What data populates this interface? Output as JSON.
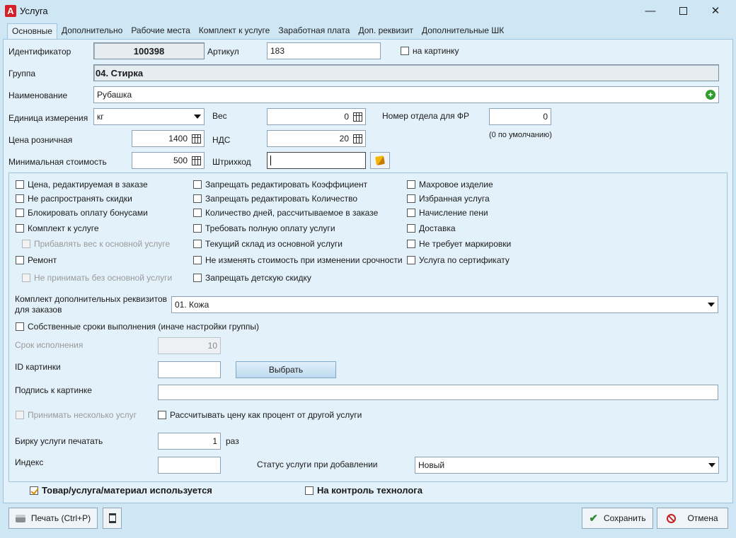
{
  "window": {
    "title": "Услуга",
    "app_icon": "A"
  },
  "tabs": [
    "Основные",
    "Дополнительно",
    "Рабочие места",
    "Комплект к услуге",
    "Заработная плата",
    "Доп. реквизит",
    "Дополнительные ШК"
  ],
  "fields": {
    "id_label": "Идентификатор",
    "id_value": "100398",
    "article_label": "Артикул",
    "article_value": "183",
    "on_picture_label": "на картинку",
    "group_label": "Группа",
    "group_value": "04. Стирка",
    "name_label": "Наименование",
    "name_value": "Рубашка",
    "unit_label": "Единица измерения",
    "unit_value": "кг",
    "weight_label": "Вес",
    "weight_value": "0",
    "dept_label": "Номер отдела для ФР",
    "dept_value": "0",
    "dept_hint": "(0 по умолчанию)",
    "price_label": "Цена розничная",
    "price_value": "1400",
    "vat_label": "НДС",
    "vat_value": "20",
    "min_cost_label": "Минимальная стоимость",
    "min_cost_value": "500",
    "barcode_label": "Штрихкод",
    "barcode_value": ""
  },
  "checks": {
    "c1": "Цена, редактируемая в заказе",
    "c2": "Не распространять скидки",
    "c3": "Блокировать оплату бонусами",
    "c4": "Комплект к услуге",
    "c5": "Прибавлять вес к основной услуге",
    "c6": "Ремонт",
    "c7": "Не принимать без основной услуги",
    "m1": "Запрещать редактировать Коэффициент",
    "m2": "Запрещать редактировать Количество",
    "m3": "Количество дней, рассчитываемое в заказе",
    "m4": "Требовать полную оплату услуги",
    "m5": "Текущий склад из основной услуги",
    "m6": "Не изменять стоимость при изменении срочности",
    "m7": "Запрещать детскую скидку",
    "r1": "Махровое изделие",
    "r2": "Избранная услуга",
    "r3": "Начисление пени",
    "r4": "Доставка",
    "r5": "Не требует маркировки",
    "r6": "Услуга по сертификату"
  },
  "extra": {
    "kit_label_1": "Комплект дополнительных реквизитов",
    "kit_label_2": "для заказов",
    "kit_value": "01. Кожа",
    "own_terms_label": "Собственные сроки выполнения (иначе настройки группы)",
    "term_label": "Срок исполнения",
    "term_value": "10",
    "pic_id_label": "ID картинки",
    "pic_id_value": "",
    "choose_label": "Выбрать",
    "caption_label": "Подпись к картинке",
    "caption_value": "",
    "multi_label": "Принимать несколько услуг",
    "percent_label": "Рассчитывать цену как процент от другой услуги",
    "tag_label": "Бирку услуги печатать",
    "tag_value": "1",
    "tag_unit": "раз",
    "index_label": "Индекс",
    "index_value": "",
    "status_label": "Статус услуги при добавлении",
    "status_value": "Новый"
  },
  "footer": {
    "used_label": "Товар/услуга/материал используется",
    "tech_label": "На контроль технолога",
    "print_label": "Печать (Ctrl+P)",
    "save_label": "Сохранить",
    "cancel_label": "Отмена"
  },
  "colors": {
    "accent_check": "#d98b00",
    "save_icon": "#2e8b2e",
    "cancel_icon": "#c41e1e"
  }
}
